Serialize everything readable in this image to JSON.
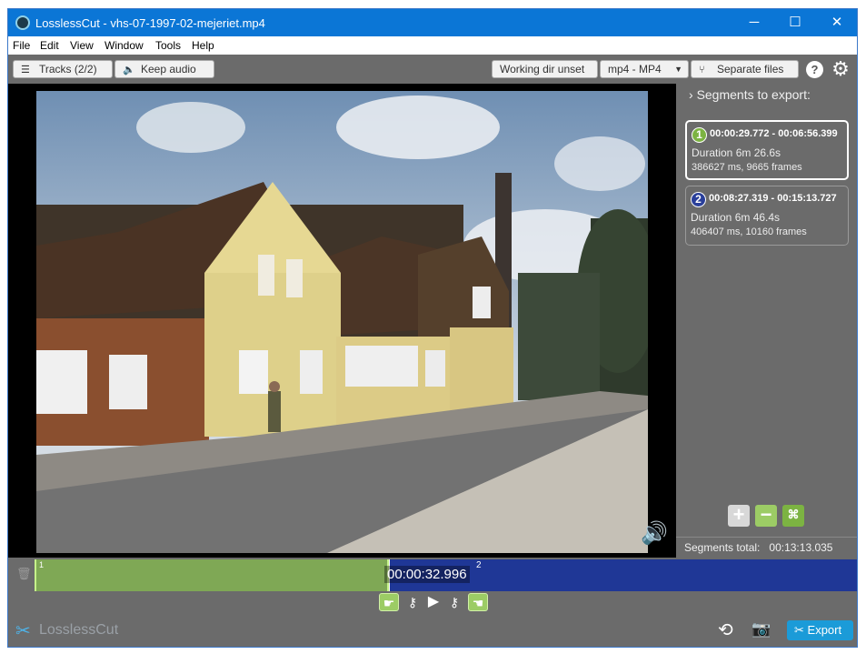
{
  "window": {
    "title": "LosslessCut - vhs-07-1997-02-mejeriet.mp4"
  },
  "titlebar_buttons": {
    "minimize": "─",
    "maximize": "☐",
    "close": "✕"
  },
  "menu": [
    "File",
    "Edit",
    "View",
    "Window",
    "Tools",
    "Help"
  ],
  "toolbar": {
    "tracks_label": "Tracks (2/2)",
    "audio_label": "Keep audio",
    "workdir_label": "Working dir unset",
    "format_label": "mp4 - MP4",
    "mode_label": "Separate files",
    "help_label": "?"
  },
  "segments_panel": {
    "heading": "Segments to export:",
    "segments": [
      {
        "num": "1",
        "range": "00:00:29.772 - 00:06:56.399",
        "duration": "Duration 6m 26.6s",
        "ms_frames": "386627 ms, 9665 frames",
        "color": "#7cb342"
      },
      {
        "num": "2",
        "range": "00:08:27.319 - 00:15:13.727",
        "duration": "Duration 6m 46.4s",
        "ms_frames": "406407 ms, 10160 frames",
        "color": "#2a3f9a"
      }
    ],
    "total_label": "Segments total:",
    "total_value": "00:13:13.035"
  },
  "timeline": {
    "current_time": "00:00:32.996",
    "segment1_fraction": 0.43,
    "playhead_fraction": 0.43,
    "segment2_label": "2",
    "segment1_label": "1"
  },
  "bottom": {
    "logo_text": "LosslessCut",
    "export_label": "Export"
  },
  "colors": {
    "accent": "#1b9bd8",
    "segment1": "#7fa855",
    "segment2": "#1f3796",
    "titlebar": "#0b76d6"
  }
}
